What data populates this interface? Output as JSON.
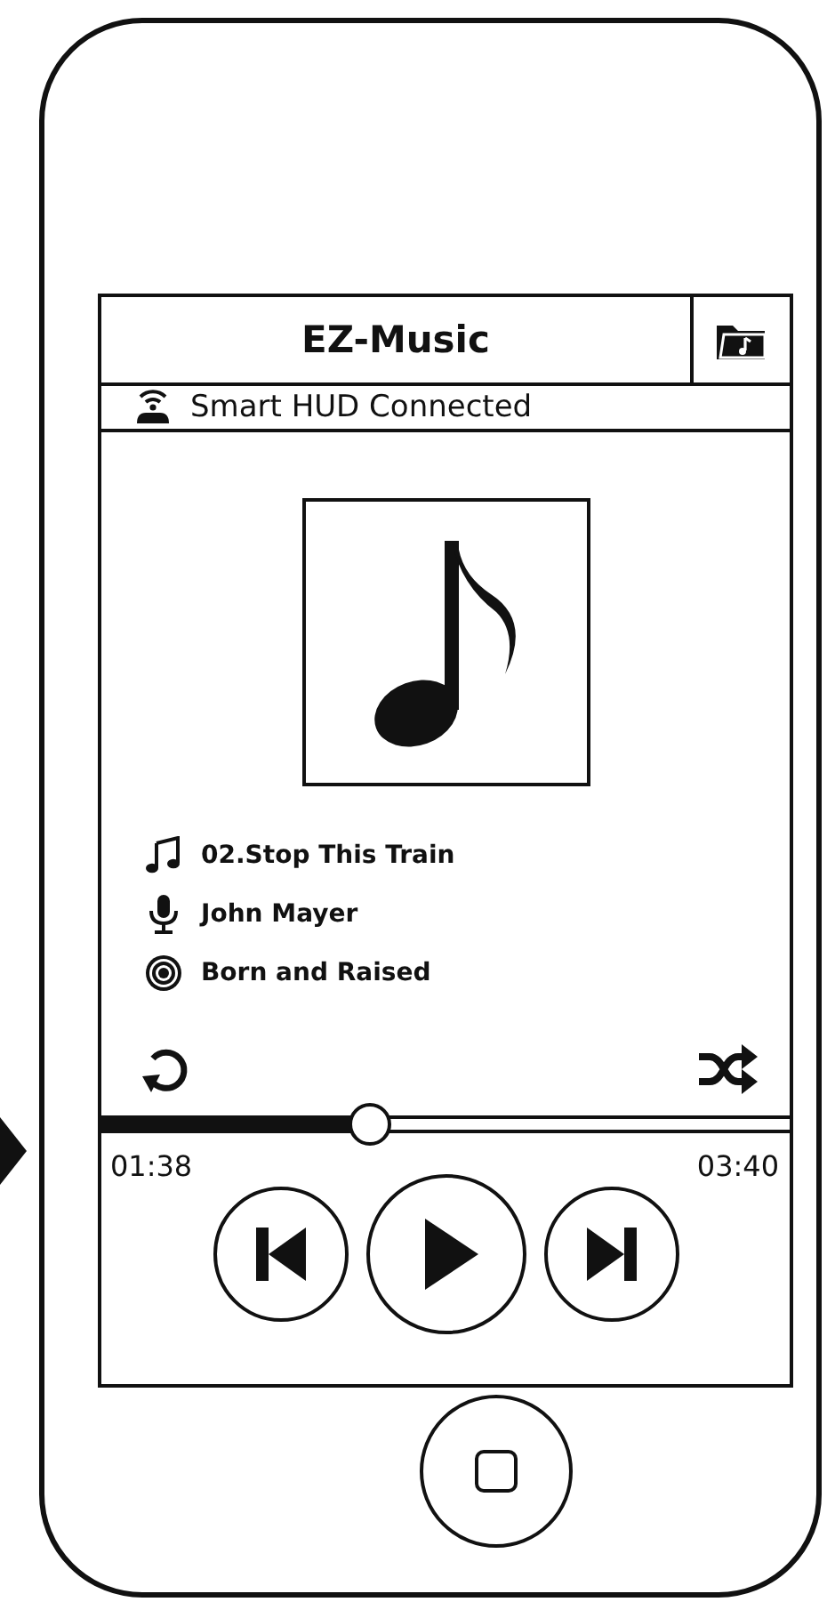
{
  "app": {
    "title": "EZ-Music"
  },
  "connection": {
    "status": "Smart HUD Connected"
  },
  "track": {
    "title": "02.Stop This Train",
    "artist": "John Mayer",
    "album": "Born and Raised"
  },
  "progress": {
    "level": 0.39,
    "elapsed": "01:38",
    "duration": "03:40"
  },
  "player": {
    "playing": false
  }
}
